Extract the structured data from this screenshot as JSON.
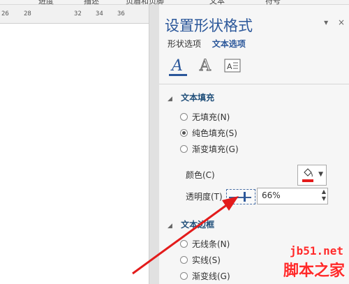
{
  "ribbon": {
    "tabs": [
      "进度",
      "描述",
      "页眉和页脚",
      "文本",
      "符号"
    ]
  },
  "ruler": {
    "ticks": [
      "26",
      "28",
      "32",
      "34",
      "36"
    ]
  },
  "pane": {
    "title": "设置形状格式",
    "close_label": "×",
    "dropdown_label": "▾",
    "subtabs": [
      "形状选项",
      "文本选项"
    ],
    "active_subtab": "文本选项",
    "icons": [
      "text-fill-outline-icon",
      "text-effects-icon",
      "textbox-icon"
    ],
    "text_fill": {
      "heading": "文本填充",
      "options": [
        "无填充(N)",
        "纯色填充(S)",
        "渐变填充(G)"
      ],
      "selected": "纯色填充(S)",
      "color_label": "颜色(C)",
      "transparency_label": "透明度(T)",
      "transparency_value": "66%",
      "transparency_fraction": 0.66,
      "accent_color": "#e31b1b"
    },
    "text_border": {
      "heading": "文本边框",
      "options": [
        "无线条(N)",
        "实线(S)",
        "渐变线(G)"
      ]
    }
  },
  "watermark": {
    "site": "jb51.net",
    "name": "脚本之家"
  }
}
